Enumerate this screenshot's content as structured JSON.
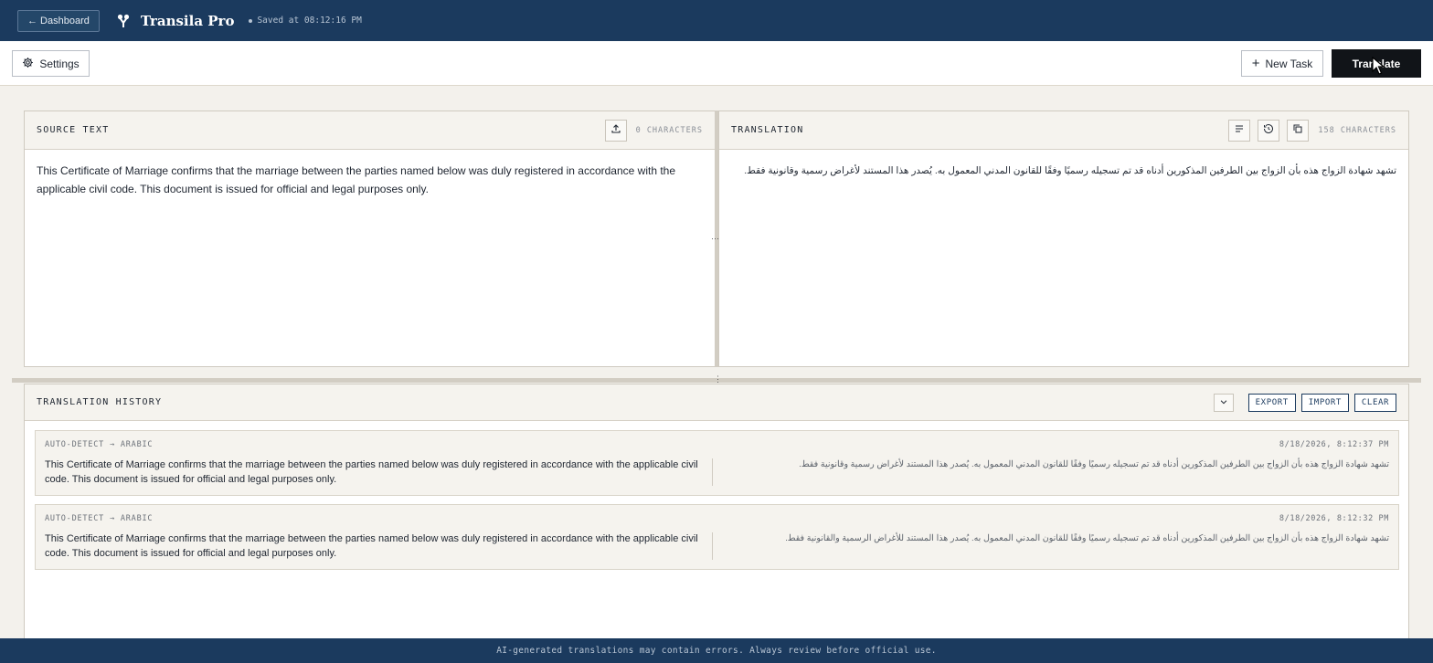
{
  "header": {
    "back_label": "← Dashboard",
    "app_title": "Transila Pro",
    "saved_status": "Saved at 08:12:16 PM"
  },
  "toolbar": {
    "settings_label": "Settings",
    "new_task_label": "New Task",
    "translate_label": "Translate"
  },
  "source": {
    "title": "SOURCE TEXT",
    "char_count": "0 CHARACTERS",
    "text": "This Certificate of Marriage confirms that the marriage between the parties named below was duly registered in accordance with the applicable civil code. This document is issued for official and legal purposes only."
  },
  "translation": {
    "title": "TRANSLATION",
    "char_count": "158 CHARACTERS",
    "text": "تشهد شهادة الزواج هذه بأن الزواج بين الطرفين المذكورين أدناه قد تم تسجيله رسميًا وفقًا للقانون المدني المعمول به. يُصدر هذا المستند لأغراض رسمية وقانونية فقط."
  },
  "history": {
    "title": "TRANSLATION HISTORY",
    "export_label": "EXPORT",
    "import_label": "IMPORT",
    "clear_label": "CLEAR",
    "entries": [
      {
        "lang": "AUTO-DETECT → ARABIC",
        "time": "8/18/2026, 8:12:37 PM",
        "source": "This Certificate of Marriage confirms that the marriage between the parties named below was duly registered in accordance with the applicable civil code. This document is issued for official and legal purposes only.",
        "target": "تشهد شهادة الزواج هذه بأن الزواج بين الطرفين المذكورين أدناه قد تم تسجيله رسميًا وفقًا للقانون المدني المعمول به. يُصدر هذا المستند لأغراض رسمية وقانونية فقط."
      },
      {
        "lang": "AUTO-DETECT → ARABIC",
        "time": "8/18/2026, 8:12:32 PM",
        "source": "This Certificate of Marriage confirms that the marriage between the parties named below was duly registered in accordance with the applicable civil code. This document is issued for official and legal purposes only.",
        "target": "تشهد شهادة الزواج هذه بأن الزواج بين الطرفين المذكورين أدناه قد تم تسجيله رسميًا وفقًا للقانون المدني المعمول به. يُصدر هذا المستند للأغراض الرسمية والقانونية فقط."
      }
    ]
  },
  "footer": {
    "disclaimer": "AI-generated translations may contain errors. Always review before official use."
  },
  "colors": {
    "header_bg": "#1b3a5e",
    "primary_button": "#111418",
    "page_bg": "#f3f1ec"
  }
}
